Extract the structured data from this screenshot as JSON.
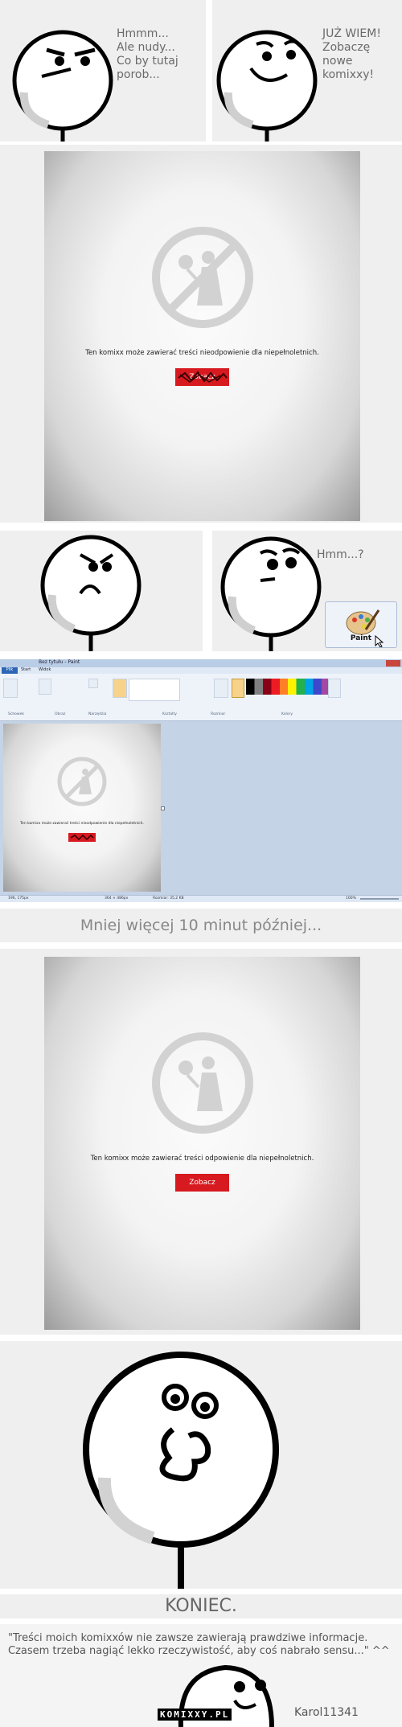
{
  "panel1": {
    "left_speech": "Hmmm...\nAle nudy...\nCo by tutaj\nporob...",
    "right_speech": "JUŻ WIEM!\nZobaczę\nnowe\nkomixxy!"
  },
  "panel2": {
    "warning_text": "Ten komixx może zawierać treści nieodpowienie dla niepełnoletnich.",
    "button_label": "Zobacz"
  },
  "panel3": {
    "speech": "Hmm...?",
    "paint_label": "Paint"
  },
  "paint_window": {
    "title": "Bez tytułu - Paint",
    "tabs": [
      "Plik",
      "Start",
      "Widok"
    ],
    "groups": [
      "Schowek",
      "Obraz",
      "Narzędzia",
      "Kształty",
      "Rozmiar",
      "Kolory"
    ],
    "warning_text": "Ten komixx może zawierać treści nieodpowienie dla niepełnoletnich.",
    "status_left": "196, 175px",
    "status_mid": "364 × 486px",
    "status_size": "Rozmiar: 35,2 KB",
    "zoom": "100%"
  },
  "caption1": "Mniej więcej 10 minut później...",
  "panel5": {
    "warning_text": "Ten komixx może zawierać treści odpowienie dla niepełnoletnich.",
    "button_label": "Zobacz"
  },
  "caption2": "KONIEC.",
  "footer": {
    "quote": "\"Treści moich komixxów nie zawsze zawierają prawdziwe informacje. Czasem trzeba nagiąć lekko rzeczywistość, aby coś nabrało sensu...\" ^^",
    "logo": "KOMIXXY.PL",
    "author": "Karol11341"
  },
  "colors": {
    "panel_bg": "#efefef",
    "red_button": "#d71920",
    "caption_text": "#888888",
    "paint_ribbon": "#dfe9f5",
    "paint_canvas_bg": "#c5d3e6"
  }
}
